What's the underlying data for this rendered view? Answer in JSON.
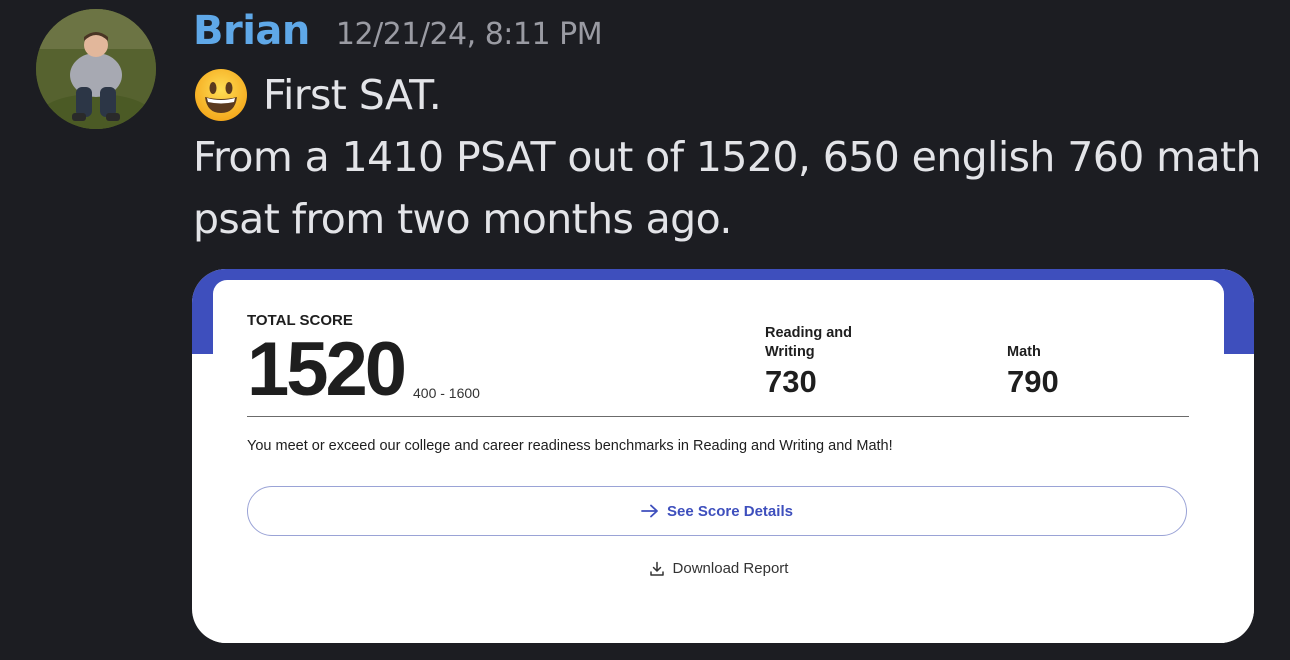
{
  "message": {
    "author": "Brian",
    "timestamp": "12/21/24, 8:11 PM",
    "emoji": "grinning-face",
    "lines": [
      "First SAT.",
      "From a 1410 PSAT out of 1520, 650 english 760 math",
      "psat from two months ago."
    ]
  },
  "colors": {
    "username": "#5fa8e8",
    "accent_blue": "#3e4fbd",
    "background": "#1c1d22"
  },
  "attachment": {
    "total_label": "TOTAL SCORE",
    "total_score": "1520",
    "total_range": "400 - 1600",
    "sections": [
      {
        "label_line1": "Reading and",
        "label_line2": "Writing",
        "score": "730"
      },
      {
        "label_line1": "",
        "label_line2": "Math",
        "score": "790"
      }
    ],
    "benchmark_text": "You meet or exceed our college and career readiness benchmarks in Reading and Writing and Math!",
    "details_button": "See Score Details",
    "download_link": "Download Report"
  }
}
